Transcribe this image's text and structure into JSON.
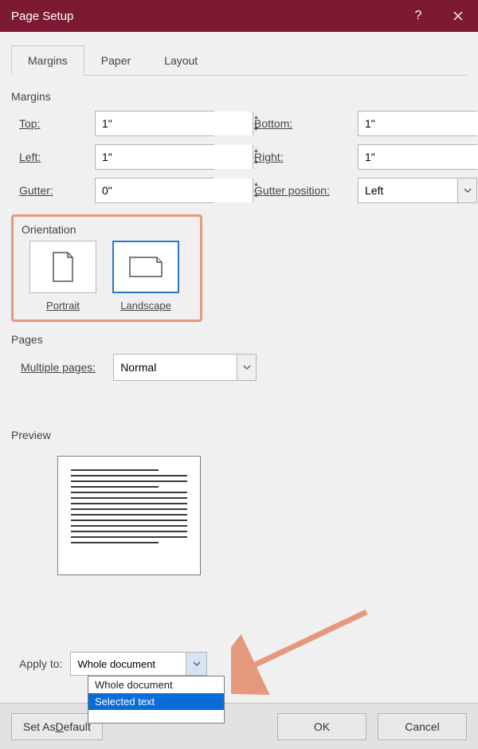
{
  "title": "Page Setup",
  "tabs": {
    "margins": "Margins",
    "paper": "Paper",
    "layout": "Layout"
  },
  "section_margins": "Margins",
  "margins": {
    "top": {
      "label_pre": "T",
      "label_u": "o",
      "label_post": "p:",
      "value": "1\""
    },
    "bottom": {
      "label_pre": "",
      "label_u": "B",
      "label_post": "ottom:",
      "value": "1\""
    },
    "left": {
      "label_pre": "",
      "label_u": "L",
      "label_post": "eft:",
      "value": "1\""
    },
    "right": {
      "label_pre": "",
      "label_u": "R",
      "label_post": "ight:",
      "value": "1\""
    },
    "gutter": {
      "label_pre": "",
      "label_u": "G",
      "label_post": "utter:",
      "value": "0\""
    },
    "gutterpos": {
      "label_pre": "G",
      "label_u": "u",
      "label_post": "tter position:",
      "value": "Left"
    }
  },
  "orientation": {
    "title": "Orientation",
    "portrait_pre": "",
    "portrait_u": "P",
    "portrait_post": "ortrait",
    "landscape_pre": "Land",
    "landscape_u": "s",
    "landscape_post": "cape"
  },
  "pages": {
    "title": "Pages",
    "multi_pre": "",
    "multi_u": "M",
    "multi_post": "ultiple pages:",
    "value": "Normal"
  },
  "preview": {
    "title": "Preview"
  },
  "apply": {
    "label": "Apply to:",
    "value": "Whole document",
    "options": {
      "whole": "Whole document",
      "selected": "Selected text"
    }
  },
  "buttons": {
    "default_pre": "Set As ",
    "default_u": "D",
    "default_post": "efault",
    "ok": "OK",
    "cancel": "Cancel"
  }
}
